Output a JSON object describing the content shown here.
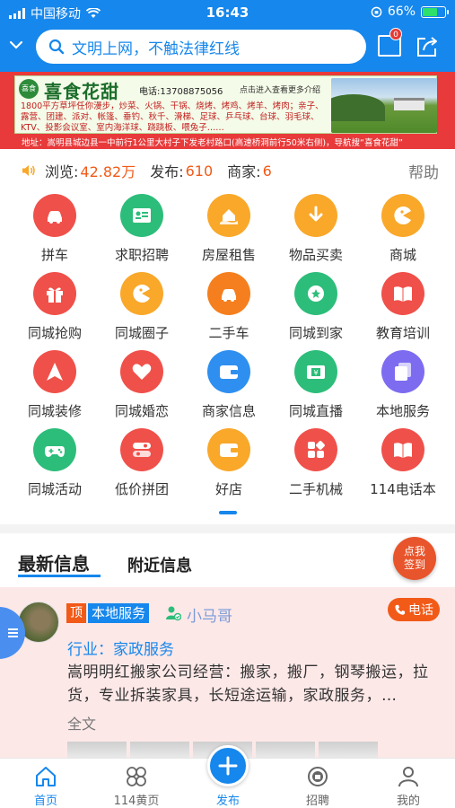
{
  "status_bar": {
    "carrier": "中国移动",
    "time": "16:43",
    "battery": "66%"
  },
  "header": {
    "search_placeholder": "文明上网，不触法律红线",
    "message_count": "0"
  },
  "banner": {
    "logo_text": "喜食",
    "name": "喜食花甜",
    "phone": "电话:13708875056",
    "tip": "点击进入查看更多介绍",
    "text": "1800平方草坪任你漫步，炒菜、火锅、干锅、烧烤、烤鸡、烤羊、烤肉；亲子、露营、团建、派对、帐篷、垂钓、秋千、滑梯、足球、乒乓球、台球、羽毛球、KTV、投影会议室、室内海洋球、跷跷板、喂兔子……",
    "address": "地址：嵩明县城边县一中前行1公里大村子下发老村路口(高速桥洞前行50米右侧)，导航搜“喜食花甜”"
  },
  "stats": {
    "views_label": "浏览:",
    "views": "42.82万",
    "posts_label": "发布:",
    "posts": "610",
    "merchants_label": "商家:",
    "merchants": "6",
    "help": "帮助"
  },
  "categories": [
    {
      "label": "拼车",
      "color": "#f0504a",
      "icon": "car-icon"
    },
    {
      "label": "求职招聘",
      "color": "#2dbd7a",
      "icon": "id-card-icon"
    },
    {
      "label": "房屋租售",
      "color": "#f9a82a",
      "icon": "house-hand-icon"
    },
    {
      "label": "物品买卖",
      "color": "#f9a82a",
      "icon": "download-arrow-icon"
    },
    {
      "label": "商城",
      "color": "#f9a82a",
      "icon": "pacman-icon"
    },
    {
      "label": "同城抢购",
      "color": "#f0504a",
      "icon": "gift-icon"
    },
    {
      "label": "同城圈子",
      "color": "#f9a82a",
      "icon": "pacman-icon"
    },
    {
      "label": "二手车",
      "color": "#f57f1e",
      "icon": "car-icon"
    },
    {
      "label": "同城到家",
      "color": "#2dbd7a",
      "icon": "badge-star-icon"
    },
    {
      "label": "教育培训",
      "color": "#f0504a",
      "icon": "book-icon"
    },
    {
      "label": "同城装修",
      "color": "#f0504a",
      "icon": "navigation-arrow-icon"
    },
    {
      "label": "同城婚恋",
      "color": "#f0504a",
      "icon": "heart-icon"
    },
    {
      "label": "商家信息",
      "color": "#2f8ff0",
      "icon": "wallet-icon"
    },
    {
      "label": "同城直播",
      "color": "#2dbd7a",
      "icon": "ticket-icon"
    },
    {
      "label": "本地服务",
      "color": "#7d6cf0",
      "icon": "copy-icon"
    },
    {
      "label": "同城活动",
      "color": "#2dbd7a",
      "icon": "gamepad-icon"
    },
    {
      "label": "低价拼团",
      "color": "#f0504a",
      "icon": "toggle-icon"
    },
    {
      "label": "好店",
      "color": "#f9a82a",
      "icon": "wallet-icon"
    },
    {
      "label": "二手机械",
      "color": "#f0504a",
      "icon": "apps-icon"
    },
    {
      "label": "114电话本",
      "color": "#f0504a",
      "icon": "book-icon"
    }
  ],
  "tabs": {
    "latest": "最新信息",
    "nearby": "附近信息"
  },
  "signin": {
    "line1": "点我",
    "line2": "签到"
  },
  "post": {
    "top_tag": "顶",
    "category": "本地服务",
    "username": "小马哥",
    "call": "电话",
    "industry": "行业：家政服务",
    "content": "嵩明明红搬家公司经营：搬家，搬厂，钢琴搬运，拉货，专业拆装家具，长短途运输，家政服务，…",
    "full_text": "全文"
  },
  "bottom_nav": [
    {
      "label": "首页",
      "icon": "home-icon",
      "active": true
    },
    {
      "label": "114黄页",
      "icon": "clover-icon",
      "active": false
    },
    {
      "label": "发布",
      "icon": "plus-icon",
      "active": true
    },
    {
      "label": "招聘",
      "icon": "hire-icon",
      "active": false
    },
    {
      "label": "我的",
      "icon": "person-icon",
      "active": false
    }
  ],
  "colors": {
    "primary": "#1687ec",
    "accent": "#f25a18",
    "banner_red": "#e83a3a",
    "post_bg": "#fde8e8"
  }
}
